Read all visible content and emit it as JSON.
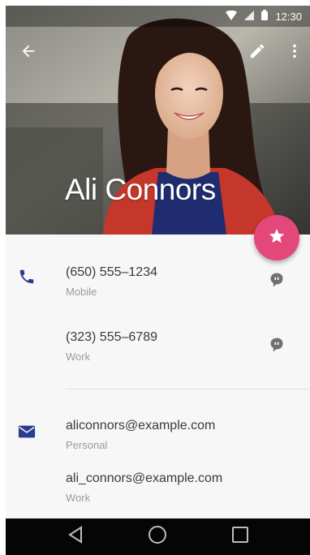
{
  "status_bar": {
    "time": "12:30",
    "icons": [
      "wifi-icon",
      "signal-icon",
      "battery-icon"
    ]
  },
  "app_bar": {
    "back_icon": "arrow-back-icon",
    "edit_icon": "pencil-icon",
    "more_icon": "more-vert-icon"
  },
  "contact": {
    "name": "Ali Connors"
  },
  "fab": {
    "icon": "star-icon",
    "color": "#e4487a"
  },
  "phones": [
    {
      "number": "(650) 555–1234",
      "type": "Mobile",
      "action_icon": "message-icon"
    },
    {
      "number": "(323) 555–6789",
      "type": "Work",
      "action_icon": "message-icon"
    }
  ],
  "emails": [
    {
      "address": "aliconnors@example.com",
      "type": "Personal"
    },
    {
      "address": "ali_connors@example.com",
      "type": "Work"
    }
  ],
  "colors": {
    "accent_icon": "#2a3c8f",
    "fab": "#e4487a",
    "nav_bar": "#050505"
  },
  "nav_bar": {
    "buttons": [
      "back-triangle-icon",
      "home-circle-icon",
      "recents-square-icon"
    ]
  }
}
